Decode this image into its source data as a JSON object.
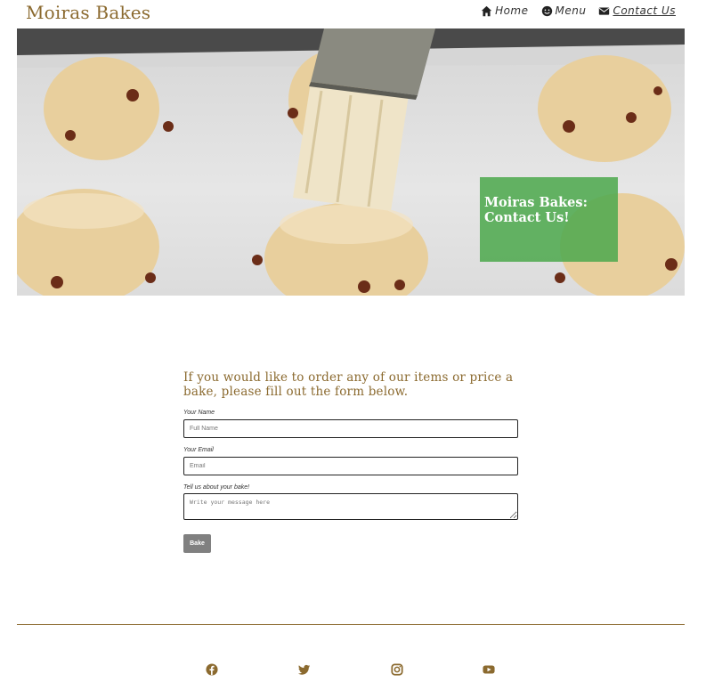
{
  "header": {
    "brand": "Moiras Bakes",
    "nav": [
      {
        "label": "Home",
        "icon": "home-icon"
      },
      {
        "label": "Menu",
        "icon": "smile-icon"
      },
      {
        "label": "Contact Us",
        "icon": "envelope-icon",
        "active": true
      }
    ]
  },
  "hero": {
    "card_line1": "Moiras Bakes:",
    "card_line2": "Contact Us!"
  },
  "form": {
    "intro": "If you would like to order any of our items or price a bake, please fill out the form below.",
    "name_label": "Your Name",
    "name_placeholder": "Full Name",
    "email_label": "Your Email",
    "email_placeholder": "Email",
    "message_label": "Tell us about your bake!",
    "message_placeholder": "Write your message here",
    "submit_label": "Bake"
  },
  "footer": {
    "socials": [
      "facebook-icon",
      "twitter-icon",
      "instagram-icon",
      "youtube-icon"
    ]
  },
  "colors": {
    "brand": "#8b6a2f",
    "card": "#50aa50",
    "button": "#808080"
  }
}
